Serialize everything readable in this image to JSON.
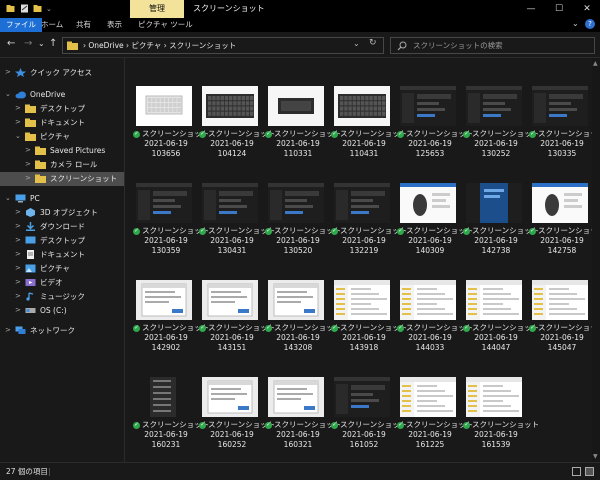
{
  "titlebar": {
    "manage_tab": "管理",
    "title": "スクリーンショット",
    "minimize": "—",
    "maximize": "☐",
    "close": "✕"
  },
  "ribbon": {
    "tabs": [
      "ファイル",
      "ホーム",
      "共有",
      "表示",
      "ピクチャ ツール"
    ]
  },
  "address": {
    "back": "←",
    "forward": "→",
    "recent": "⌄",
    "up": "↑",
    "crumbs": "›  OneDrive  ›  ピクチャ  ›  スクリーンショット",
    "dropdown": "⌄",
    "refresh": "↻"
  },
  "search": {
    "placeholder": "スクリーンショットの検索"
  },
  "nav": [
    {
      "label": "クイック アクセス",
      "icon": "star-icon",
      "chev": ">"
    },
    {
      "label": "OneDrive",
      "icon": "cloud-icon",
      "chev": "⌄"
    },
    {
      "label": "デスクトップ",
      "icon": "folder-icon",
      "chev": ">"
    },
    {
      "label": "ドキュメント",
      "icon": "folder-icon",
      "chev": ">"
    },
    {
      "label": "ピクチャ",
      "icon": "folder-icon",
      "chev": "⌄"
    },
    {
      "label": "Saved Pictures",
      "icon": "folder-icon",
      "chev": ">"
    },
    {
      "label": "カメラ ロール",
      "icon": "folder-icon",
      "chev": ">"
    },
    {
      "label": "スクリーンショット",
      "icon": "folder-icon",
      "chev": ">"
    },
    {
      "label": "PC",
      "icon": "pc-icon",
      "chev": "⌄"
    },
    {
      "label": "3D オブジェクト",
      "icon": "cube-icon",
      "chev": ">"
    },
    {
      "label": "ダウンロード",
      "icon": "download-icon",
      "chev": ">"
    },
    {
      "label": "デスクトップ",
      "icon": "desktop-icon",
      "chev": ">"
    },
    {
      "label": "ドキュメント",
      "icon": "document-icon",
      "chev": ">"
    },
    {
      "label": "ピクチャ",
      "icon": "picture-icon",
      "chev": ">"
    },
    {
      "label": "ビデオ",
      "icon": "video-icon",
      "chev": ">"
    },
    {
      "label": "ミュージック",
      "icon": "music-icon",
      "chev": ">"
    },
    {
      "label": "OS (C:)",
      "icon": "drive-icon",
      "chev": ">"
    },
    {
      "label": "ネットワーク",
      "icon": "network-icon",
      "chev": ">"
    }
  ],
  "files": [
    {
      "name": "スクリーンショット",
      "date": "2021-06-19",
      "time": "103656",
      "thumb": "keyboard-white"
    },
    {
      "name": "スクリーンショット",
      "date": "2021-06-19",
      "time": "104124",
      "thumb": "keyboard-dark"
    },
    {
      "name": "スクリーンショット",
      "date": "2021-06-19",
      "time": "110331",
      "thumb": "keyboard-dark2"
    },
    {
      "name": "スクリーンショット",
      "date": "2021-06-19",
      "time": "110431",
      "thumb": "keyboard-dark"
    },
    {
      "name": "スクリーンショット",
      "date": "2021-06-19",
      "time": "125653",
      "thumb": "app-dark"
    },
    {
      "name": "スクリーンショット",
      "date": "2021-06-19",
      "time": "130252",
      "thumb": "app-dark"
    },
    {
      "name": "スクリーンショット",
      "date": "2021-06-19",
      "time": "130335",
      "thumb": "app-dark"
    },
    {
      "name": "スクリーンショット",
      "date": "2021-06-19",
      "time": "130359",
      "thumb": "app-dark"
    },
    {
      "name": "スクリーンショット",
      "date": "2021-06-19",
      "time": "130431",
      "thumb": "app-dark"
    },
    {
      "name": "スクリーンショット",
      "date": "2021-06-19",
      "time": "130520",
      "thumb": "app-dark"
    },
    {
      "name": "スクリーンショット",
      "date": "2021-06-19",
      "time": "132219",
      "thumb": "app-dark"
    },
    {
      "name": "スクリーンショット",
      "date": "2021-06-19",
      "time": "140309",
      "thumb": "mouse-white"
    },
    {
      "name": "スクリーンショット",
      "date": "2021-06-19",
      "time": "142738",
      "thumb": "app-blue"
    },
    {
      "name": "スクリーンショット",
      "date": "2021-06-19",
      "time": "142758",
      "thumb": "mouse-white"
    },
    {
      "name": "スクリーンショット",
      "date": "2021-06-19",
      "time": "142902",
      "thumb": "dialog-white"
    },
    {
      "name": "スクリーンショット",
      "date": "2021-06-19",
      "time": "143151",
      "thumb": "dialog-white"
    },
    {
      "name": "スクリーンショット",
      "date": "2021-06-19",
      "time": "143208",
      "thumb": "dialog-white"
    },
    {
      "name": "スクリーンショット",
      "date": "2021-06-19",
      "time": "143918",
      "thumb": "explorer-white"
    },
    {
      "name": "スクリーンショット",
      "date": "2021-06-19",
      "time": "144033",
      "thumb": "explorer-white"
    },
    {
      "name": "スクリーンショット",
      "date": "2021-06-19",
      "time": "144047",
      "thumb": "explorer-white"
    },
    {
      "name": "スクリーンショット",
      "date": "2021-06-19",
      "time": "145047",
      "thumb": "explorer-white"
    },
    {
      "name": "スクリーンショット",
      "date": "2021-06-19",
      "time": "160231",
      "thumb": "menu-dark"
    },
    {
      "name": "スクリーンショット",
      "date": "2021-06-19",
      "time": "160252",
      "thumb": "dialog-white"
    },
    {
      "name": "スクリーンショット",
      "date": "2021-06-19",
      "time": "160321",
      "thumb": "dialog-white"
    },
    {
      "name": "スクリーンショット",
      "date": "2021-06-19",
      "time": "161052",
      "thumb": "app-dark"
    },
    {
      "name": "スクリーンショット",
      "date": "2021-06-19",
      "time": "161225",
      "thumb": "explorer-white"
    },
    {
      "name": "スクリーンショット",
      "date": "2021-06-19",
      "time": "161539",
      "thumb": "explorer-white"
    }
  ],
  "status": {
    "count": "27 個の項目",
    "separator": "|"
  },
  "colors": {
    "accent": "#1d6fd6",
    "manage_tab": "#f2e29a",
    "sync_ok": "#2ea84b",
    "selected": "#4d4d4d"
  }
}
